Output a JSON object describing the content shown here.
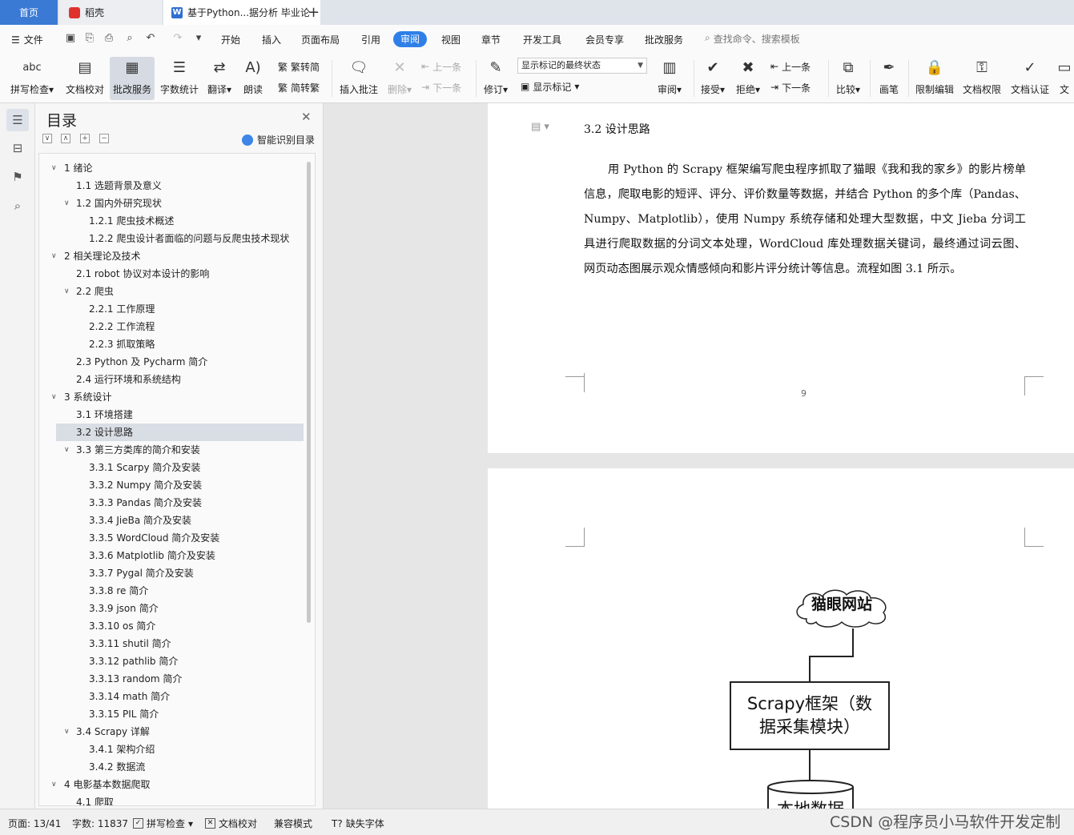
{
  "tabs": {
    "home": "首页",
    "daoke": "稻壳",
    "document": "基于Python...据分析 毕业论"
  },
  "menu": {
    "file": "文件",
    "items": [
      "开始",
      "插入",
      "页面布局",
      "引用",
      "审阅",
      "视图",
      "章节",
      "开发工具",
      "会员专享",
      "批改服务"
    ],
    "active": "审阅",
    "search_placeholder": "查找命令、搜索模板"
  },
  "ribbon": {
    "spellcheck": "拼写检查",
    "doc_proof": "文档校对",
    "correction_service": "批改服务",
    "word_count": "字数统计",
    "translate": "翻译",
    "read_aloud": "朗读",
    "trad_to_simp": "繁转简",
    "simp_to_trad": "简转繁",
    "insert_comment": "插入批注",
    "delete": "删除",
    "prev_comment": "上一条",
    "next_comment": "下一条",
    "track_changes": "修订",
    "markup_state": "显示标记的最终状态",
    "show_markup": "显示标记",
    "review": "审阅",
    "accept": "接受",
    "reject": "拒绝",
    "prev_change": "上一条",
    "next_change": "下一条",
    "compare": "比较",
    "ink": "画笔",
    "restrict_edit": "限制编辑",
    "doc_permission": "文档权限",
    "doc_auth": "文档认证",
    "doc_cut": "文"
  },
  "toc": {
    "title": "目录",
    "smart": "智能识别目录",
    "items": [
      {
        "text": "1  绪论",
        "level": 1,
        "twisty": "∨"
      },
      {
        "text": "1.1  选题背景及意义",
        "level": 2,
        "twisty": ""
      },
      {
        "text": "1.2  国内外研究现状",
        "level": 2,
        "twisty": "∨"
      },
      {
        "text": "1.2.1  爬虫技术概述",
        "level": 3,
        "twisty": ""
      },
      {
        "text": "1.2.2  爬虫设计者面临的问题与反爬虫技术现状",
        "level": 3,
        "twisty": ""
      },
      {
        "text": "2  相关理论及技术",
        "level": 1,
        "twisty": "∨"
      },
      {
        "text": "2.1 robot 协议对本设计的影响",
        "level": 2,
        "twisty": ""
      },
      {
        "text": "2.2  爬虫",
        "level": 2,
        "twisty": "∨"
      },
      {
        "text": "2.2.1  工作原理",
        "level": 3,
        "twisty": ""
      },
      {
        "text": "2.2.2  工作流程",
        "level": 3,
        "twisty": ""
      },
      {
        "text": "2.2.3  抓取策略",
        "level": 3,
        "twisty": ""
      },
      {
        "text": "2.3 Python 及 Pycharm 简介",
        "level": 2,
        "twisty": ""
      },
      {
        "text": "2.4 运行环境和系统结构",
        "level": 2,
        "twisty": ""
      },
      {
        "text": "3  系统设计",
        "level": 1,
        "twisty": "∨"
      },
      {
        "text": "3.1 环境搭建",
        "level": 2,
        "twisty": ""
      },
      {
        "text": "3.2 设计思路",
        "level": 2,
        "twisty": "",
        "selected": true
      },
      {
        "text": "3.3  第三方类库的简介和安装",
        "level": 2,
        "twisty": "∨"
      },
      {
        "text": "3.3.1 Scarpy 简介及安装",
        "level": 3,
        "twisty": ""
      },
      {
        "text": "3.3.2 Numpy 简介及安装",
        "level": 3,
        "twisty": ""
      },
      {
        "text": "3.3.3 Pandas 简介及安装",
        "level": 3,
        "twisty": ""
      },
      {
        "text": "3.3.4 JieBa 简介及安装",
        "level": 3,
        "twisty": ""
      },
      {
        "text": "3.3.5 WordCloud 简介及安装",
        "level": 3,
        "twisty": ""
      },
      {
        "text": "3.3.6 Matplotlib 简介及安装",
        "level": 3,
        "twisty": ""
      },
      {
        "text": "3.3.7 Pygal 简介及安装",
        "level": 3,
        "twisty": ""
      },
      {
        "text": "3.3.8 re 简介",
        "level": 3,
        "twisty": ""
      },
      {
        "text": "3.3.9 json 简介",
        "level": 3,
        "twisty": ""
      },
      {
        "text": "3.3.10 os 简介",
        "level": 3,
        "twisty": ""
      },
      {
        "text": "3.3.11 shutil 简介",
        "level": 3,
        "twisty": ""
      },
      {
        "text": "3.3.12 pathlib 简介",
        "level": 3,
        "twisty": ""
      },
      {
        "text": "3.3.13 random 简介",
        "level": 3,
        "twisty": ""
      },
      {
        "text": "3.3.14 math 简介",
        "level": 3,
        "twisty": ""
      },
      {
        "text": "3.3.15 PIL 简介",
        "level": 3,
        "twisty": ""
      },
      {
        "text": "3.4 Scrapy 详解",
        "level": 2,
        "twisty": "∨"
      },
      {
        "text": "3.4.1  架构介绍",
        "level": 3,
        "twisty": ""
      },
      {
        "text": "3.4.2  数据流",
        "level": 3,
        "twisty": ""
      },
      {
        "text": "4  电影基本数据爬取",
        "level": 1,
        "twisty": "∨"
      },
      {
        "text": "4.1 爬取",
        "level": 2,
        "twisty": ""
      }
    ]
  },
  "document": {
    "heading": "3.2 设计思路",
    "paragraph": "用 Python 的 Scrapy 框架编写爬虫程序抓取了猫眼《我和我的家乡》的影片榜单信息，爬取电影的短评、评分、评价数量等数据，并结合 Python 的多个库（Pandas、Numpy、Matplotlib），使用 Numpy 系统存储和处理大型数据，中文 Jieba 分词工具进行爬取数据的分词文本处理，WordCloud 库处理数据关键词，最终通过词云图、网页动态图展示观众情感倾向和影片评分统计等信息。流程如图 3.1 所示。",
    "page_number": "9",
    "flow_cloud": "猫眼网站",
    "flow_box": "Scrapy框架（数据采集模块）",
    "flow_db": "本地数据"
  },
  "status": {
    "page": "页面: 13/41",
    "words": "字数: 11837",
    "spellcheck": "拼写检查",
    "proof": "文档校对",
    "compat": "兼容模式",
    "missing_font": "缺失字体"
  },
  "watermark": "CSDN @程序员小马软件开发定制",
  "colors": {
    "accent": "#2f7fe8",
    "home_tab": "#3a7ad5"
  }
}
